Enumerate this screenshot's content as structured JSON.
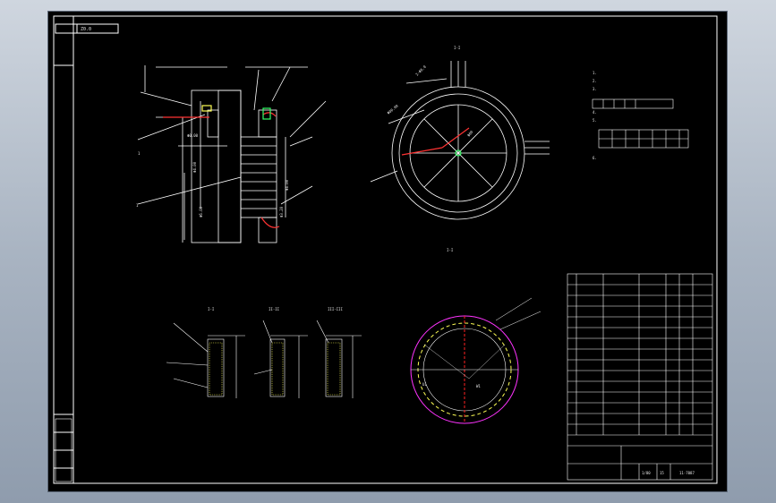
{
  "title_block": {
    "top_left_label": "Z0.0"
  },
  "section_labels": [
    "I-I",
    "II-II",
    "III-III"
  ],
  "drawing_number": "11-7087",
  "scale_row": {
    "a": "1/80",
    "b": "15"
  },
  "tech_notes": {
    "line1": "1.",
    "line2": "2.",
    "line3": "3.",
    "line4": "4.",
    "line5": "5.",
    "line6": "6."
  },
  "colors": {
    "background": "#000000",
    "line": "#ffffff",
    "yellow": "#ffff55",
    "magenta": "#ff33ff",
    "red": "#ff2222",
    "green": "#33ff66",
    "frame_bg": "#9aa6b6"
  }
}
